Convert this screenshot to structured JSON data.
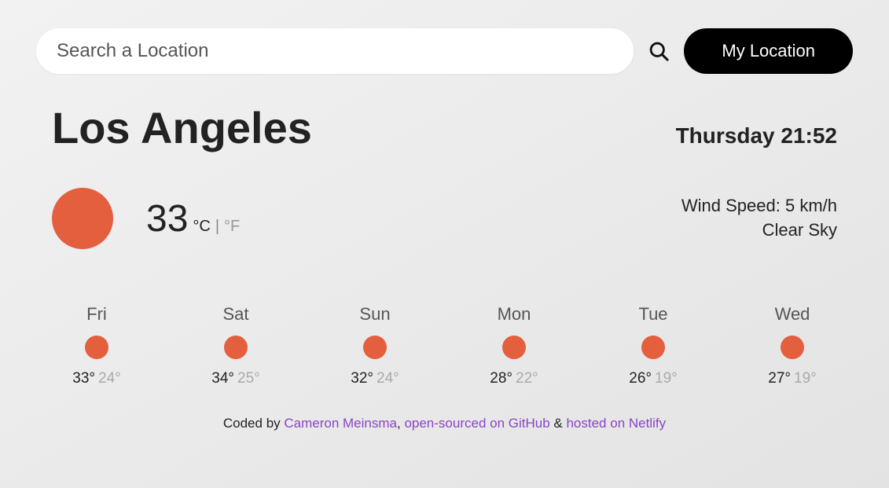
{
  "search": {
    "placeholder": "Search a Location",
    "value": ""
  },
  "buttons": {
    "my_location": "My Location"
  },
  "header": {
    "city": "Los Angeles",
    "datetime": "Thursday 21:52"
  },
  "current": {
    "temp": "33",
    "unit_c": "°C",
    "unit_sep": "|",
    "unit_f": "°F",
    "wind_label": "Wind Speed:",
    "wind_value": "5 km/h",
    "condition": "Clear Sky"
  },
  "forecast": [
    {
      "day": "Fri",
      "hi": "33°",
      "lo": "24°"
    },
    {
      "day": "Sat",
      "hi": "34°",
      "lo": "25°"
    },
    {
      "day": "Sun",
      "hi": "32°",
      "lo": "24°"
    },
    {
      "day": "Mon",
      "hi": "28°",
      "lo": "22°"
    },
    {
      "day": "Tue",
      "hi": "26°",
      "lo": "19°"
    },
    {
      "day": "Wed",
      "hi": "27°",
      "lo": "19°"
    }
  ],
  "footer": {
    "coded_by": "Coded by ",
    "author": "Cameron Meinsma",
    "sep1": ", ",
    "open_source": "open-sourced on GitHub",
    "sep2": " & ",
    "hosted": "hosted on Netlify"
  },
  "colors": {
    "accent": "#e45f3e",
    "link": "#8a44c6"
  }
}
